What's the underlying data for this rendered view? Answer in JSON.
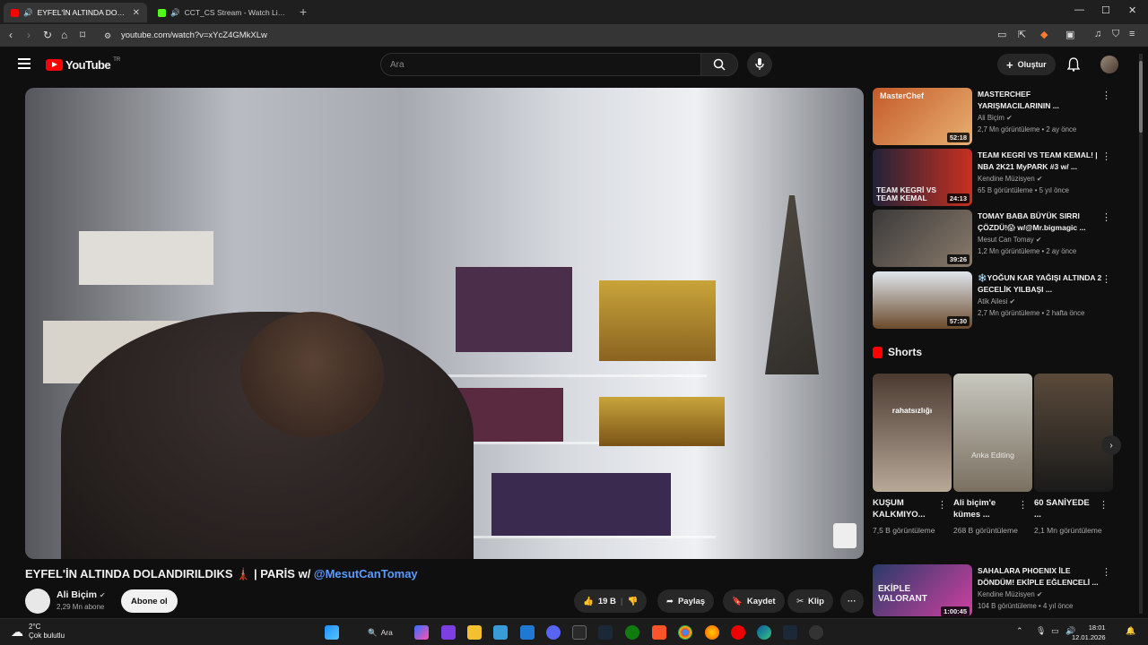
{
  "browser": {
    "tabs": [
      {
        "label": "EYFEL'İN ALTINDA DOLANDIRILDIKS",
        "active": true,
        "color": "#ff0000"
      },
      {
        "label": "CCT_CS Stream - Watch Live on Kick",
        "active": false,
        "color": "#53fc18"
      }
    ],
    "new_tab": "+",
    "window": {
      "minimize": "—",
      "maximize": "☐",
      "close": "✕"
    },
    "url": "youtube.com/watch?v=xYcZ4GMkXLw"
  },
  "header": {
    "logo_text": "YouTube",
    "region": "TR",
    "search_placeholder": "Ara",
    "create_label": "Oluştur"
  },
  "video": {
    "title_main": "EYFEL'İN ALTINDA DOLANDIRILDIKS 🗼 | PARİS w/ ",
    "title_mention": "@MesutCanTomay",
    "channel_name": "Ali Biçim",
    "subscribers": "2,29 Mn abone",
    "subscribe_label": "Abone ol",
    "likes": "19 B",
    "share_label": "Paylaş",
    "save_label": "Kaydet",
    "clip_label": "Klip",
    "more": "···"
  },
  "recommendations": [
    {
      "title": "MASTERCHEF YARIŞMACILARININ ...",
      "channel": "Ali Biçim",
      "verified": true,
      "meta": "2,7 Mn görüntüleme • 2 ay önce",
      "duration": "52:18",
      "thumb_a": "#c45a2a",
      "thumb_b": "#e8b070",
      "thumb_text": "MasterChef"
    },
    {
      "title": "TEAM KEGRİ VS TEAM KEMAL! | NBA 2K21 MyPARK #3 w/ ...",
      "channel": "Kendine Müzisyen",
      "verified": true,
      "meta": "65 B görüntüleme • 5 yıl önce",
      "duration": "24:13",
      "thumb_a": "#222238",
      "thumb_b": "#c83020",
      "thumb_text": "TEAM KEGRİ VS TEAM KEMAL"
    },
    {
      "title": "TOMAY BABA BÜYÜK SIRRI ÇÖZDÜ!😱 w/@Mr.bigmagic ...",
      "channel": "Mesut Can Tomay",
      "verified": true,
      "meta": "1,2 Mn görüntüleme • 2 ay önce",
      "duration": "39:26",
      "thumb_a": "#3a3a3a",
      "thumb_b": "#8a7a6a",
      "thumb_text": ""
    },
    {
      "title": "❄️YOĞUN KAR YAĞIŞI ALTINDA 2 GECELİK YILBAŞI ...",
      "channel": "Atik Ailesi",
      "verified": true,
      "meta": "2,7 Mn görüntüleme • 2 hafta önce",
      "duration": "57:30",
      "thumb_a": "#dfe6ee",
      "thumb_b": "#6b4a2a",
      "thumb_text": ""
    }
  ],
  "shorts": {
    "heading": "Shorts",
    "items": [
      {
        "overlay": "rahatsızlığı",
        "title": "KUŞUM KALKMIYO...",
        "views": "7,5 B görüntüleme",
        "thumb_a": "#4a3a30",
        "thumb_b": "#b8a898"
      },
      {
        "overlay": "Anka Editing",
        "title": "Ali biçim'e kümes ...",
        "views": "268 B görüntüleme",
        "thumb_a": "#c8c8c0",
        "thumb_b": "#7a7060"
      },
      {
        "overlay": "",
        "title": "60 SANİYEDE ...",
        "views": "2,1 Mn görüntüleme",
        "thumb_a": "#1a1a1a",
        "thumb_b": "#5a4a3a"
      }
    ]
  },
  "rec_bottom": {
    "title": "SAHALARA PHOENIX İLE DÖNDÜM! EKİPLE EĞLENCELİ ...",
    "channel": "Kendine Müzisyen",
    "verified": true,
    "meta": "104 B görüntüleme • 4 yıl önce",
    "duration": "1:00:45",
    "thumb_a": "#2a3a6a",
    "thumb_b": "#d040a0",
    "thumb_text": "EKİPLE VALORANT"
  },
  "taskbar": {
    "temperature": "2°C",
    "weather": "Çok bulutlu",
    "search_label": "Ara",
    "time": "18:01",
    "date": "12.01.2026"
  }
}
